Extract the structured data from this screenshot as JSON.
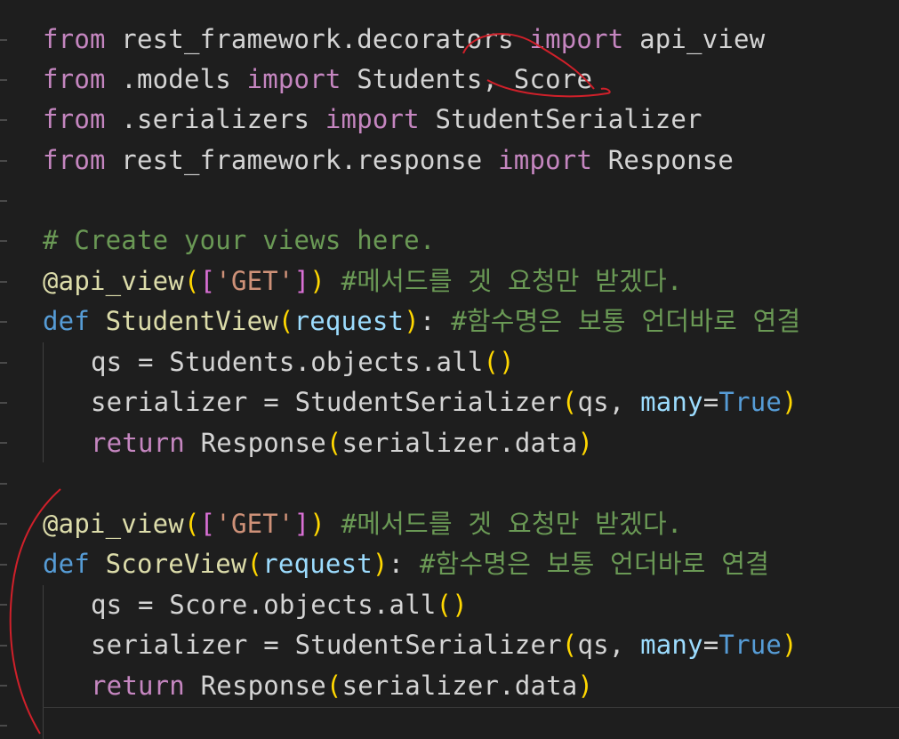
{
  "code": {
    "l1": {
      "a": "from",
      "b": " rest_framework.decorators ",
      "c": "import",
      "d": " api_view"
    },
    "l2": {
      "a": "from",
      "b": " .models ",
      "c": "import",
      "d": " Students, Score"
    },
    "l3": {
      "a": "from",
      "b": " .serializers ",
      "c": "import",
      "d": " StudentSerializer"
    },
    "l4": {
      "a": "from",
      "b": " rest_framework.response ",
      "c": "import",
      "d": " Response"
    },
    "l5": {
      "comment": "# Create your views here."
    },
    "l6": {
      "deco": "@api_view",
      "p1": "(",
      "b1": "[",
      "str": "'GET'",
      "b2": "]",
      "p2": ")",
      "comment": " #메서드를 겟 요청만 받겠다."
    },
    "l7": {
      "kw": "def",
      "name": " StudentView",
      "p1": "(",
      "param": "request",
      "p2": ")",
      "colon": ":",
      "comment": " #함수명은 보통 언더바로 연결"
    },
    "l8": {
      "a": "qs = Students.objects.all",
      "p1": "(",
      "p2": ")"
    },
    "l9": {
      "a": "serializer = StudentSerializer",
      "p1": "(",
      "b": "qs, ",
      "kw": "many",
      "eq": "=",
      "val": "True",
      "p2": ")"
    },
    "l10": {
      "kw": "return",
      "b": " Response",
      "p1": "(",
      "c": "serializer.data",
      "p2": ")"
    },
    "l11": {
      "deco": "@api_view",
      "p1": "(",
      "b1": "[",
      "str": "'GET'",
      "b2": "]",
      "p2": ")",
      "comment": " #메서드를 겟 요청만 받겠다."
    },
    "l12": {
      "kw": "def",
      "name": " ScoreView",
      "p1": "(",
      "param": "request",
      "p2": ")",
      "colon": ":",
      "comment": " #함수명은 보통 언더바로 연결"
    },
    "l13": {
      "a": "qs = Score.objects.all",
      "p1": "(",
      "p2": ")"
    },
    "l14": {
      "a": "serializer = StudentSerializer",
      "p1": "(",
      "b": "qs, ",
      "kw": "many",
      "eq": "=",
      "val": "True",
      "p2": ")"
    },
    "l15": {
      "kw": "return",
      "b": " Response",
      "p1": "(",
      "c": "serializer.data",
      "p2": ")"
    }
  },
  "colors": {
    "background": "#1e1e1e",
    "keyword_import": "#c586c0",
    "keyword_def": "#569cd6",
    "function_name": "#dcdcaa",
    "comment": "#6a9955",
    "string": "#ce9178",
    "annotation_ink": "#d0202a"
  }
}
